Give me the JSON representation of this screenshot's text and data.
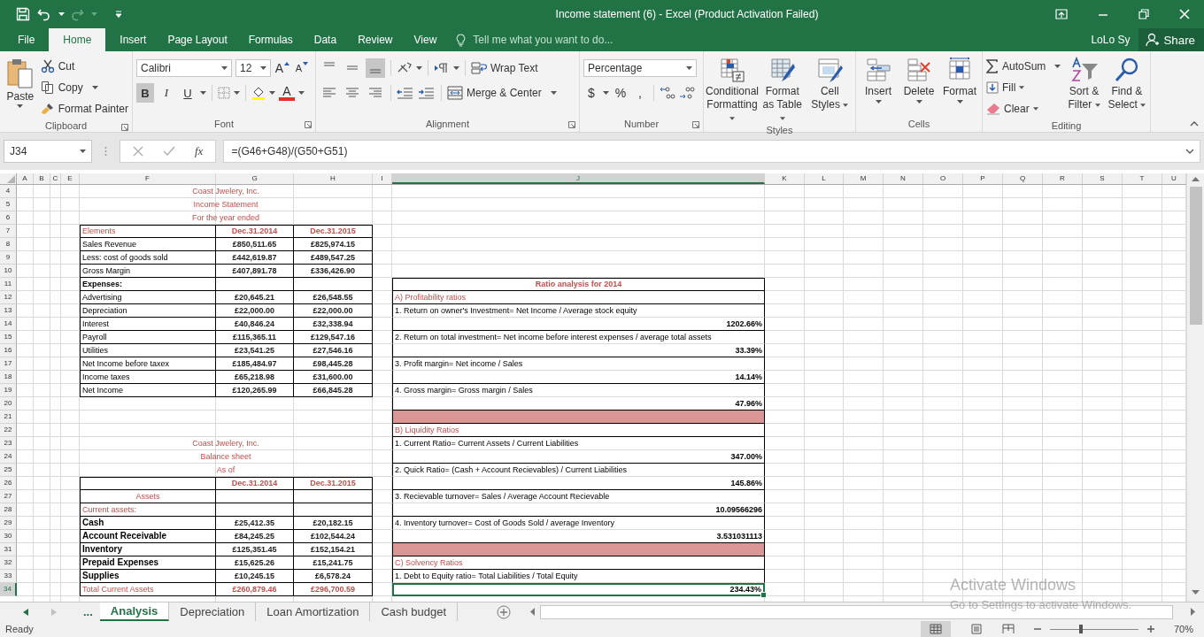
{
  "window": {
    "title": "Income statement (6) - Excel (Product Activation Failed)"
  },
  "ribbon_tabs": [
    {
      "label": "File",
      "selected": false
    },
    {
      "label": "Home",
      "selected": true
    },
    {
      "label": "Insert",
      "selected": false
    },
    {
      "label": "Page Layout",
      "selected": false
    },
    {
      "label": "Formulas",
      "selected": false
    },
    {
      "label": "Data",
      "selected": false
    },
    {
      "label": "Review",
      "selected": false
    },
    {
      "label": "View",
      "selected": false
    }
  ],
  "tell_me": {
    "placeholder": "Tell me what you want to do..."
  },
  "account": {
    "user": "LoLo Sy",
    "share": "Share"
  },
  "ribbon": {
    "clipboard": {
      "label": "Clipboard",
      "paste": "Paste",
      "cut": "Cut",
      "copy": "Copy",
      "format_painter": "Format Painter"
    },
    "font": {
      "label": "Font",
      "font_name": "Calibri",
      "font_size": "12",
      "grow": "A",
      "shrink": "A",
      "styles": [
        {
          "label": "B",
          "on": true
        },
        {
          "label": "I",
          "on": false
        },
        {
          "label": "U",
          "on": false
        }
      ],
      "font_color": "A"
    },
    "alignment": {
      "label": "Alignment",
      "vertical": [
        {
          "on": false
        },
        {
          "on": false
        },
        {
          "on": true
        }
      ],
      "wrap_text": "Wrap Text",
      "merge_center": "Merge & Center"
    },
    "number": {
      "label": "Number",
      "format": "Percentage",
      "currency": "$",
      "percent": "%",
      "comma": ","
    },
    "styles": {
      "label": "Styles",
      "commands": [
        "Conditional Formatting",
        "Format as Table",
        "Cell Styles"
      ]
    },
    "cells": {
      "label": "Cells",
      "commands": [
        "Insert",
        "Delete",
        "Format"
      ]
    },
    "editing": {
      "label": "Editing",
      "autosum": "AutoSum",
      "fill": "Fill",
      "clear": "Clear",
      "sort_filter": "Sort & Filter",
      "find_select": "Find & Select"
    }
  },
  "formula_bar": {
    "name_box": "J34",
    "function_label": "fx",
    "formula": "=(G46+G48)/(G50+G51)"
  },
  "sheet": {
    "column_headers": [
      {
        "label": "A",
        "selected": false
      },
      {
        "label": "B",
        "selected": false
      },
      {
        "label": "C",
        "selected": false
      },
      {
        "label": "E",
        "selected": false
      },
      {
        "label": "F",
        "selected": false
      },
      {
        "label": "G",
        "selected": false
      },
      {
        "label": "H",
        "selected": false
      },
      {
        "label": "I",
        "selected": false
      },
      {
        "label": "J",
        "selected": true
      },
      {
        "label": "K",
        "selected": false
      },
      {
        "label": "L",
        "selected": false
      },
      {
        "label": "M",
        "selected": false
      },
      {
        "label": "N",
        "selected": false
      },
      {
        "label": "O",
        "selected": false
      },
      {
        "label": "P",
        "selected": false
      },
      {
        "label": "Q",
        "selected": false
      },
      {
        "label": "R",
        "selected": false
      },
      {
        "label": "S",
        "selected": false
      },
      {
        "label": "T",
        "selected": false
      },
      {
        "label": "U",
        "selected": false
      }
    ],
    "row_headers": [
      {
        "label": "4",
        "selected": false
      },
      {
        "label": "5",
        "selected": false
      },
      {
        "label": "6",
        "selected": false
      },
      {
        "label": "7",
        "selected": false
      },
      {
        "label": "8",
        "selected": false
      },
      {
        "label": "9",
        "selected": false
      },
      {
        "label": "10",
        "selected": false
      },
      {
        "label": "11",
        "selected": false
      },
      {
        "label": "12",
        "selected": false
      },
      {
        "label": "13",
        "selected": false
      },
      {
        "label": "14",
        "selected": false
      },
      {
        "label": "15",
        "selected": false
      },
      {
        "label": "16",
        "selected": false
      },
      {
        "label": "17",
        "selected": false
      },
      {
        "label": "18",
        "selected": false
      },
      {
        "label": "19",
        "selected": false
      },
      {
        "label": "20",
        "selected": false
      },
      {
        "label": "21",
        "selected": false
      },
      {
        "label": "22",
        "selected": false
      },
      {
        "label": "23",
        "selected": false
      },
      {
        "label": "24",
        "selected": false
      },
      {
        "label": "25",
        "selected": false
      },
      {
        "label": "26",
        "selected": false
      },
      {
        "label": "27",
        "selected": false
      },
      {
        "label": "28",
        "selected": false
      },
      {
        "label": "29",
        "selected": false
      },
      {
        "label": "30",
        "selected": false
      },
      {
        "label": "31",
        "selected": false
      },
      {
        "label": "32",
        "selected": false
      },
      {
        "label": "33",
        "selected": false
      },
      {
        "label": "34",
        "selected": true
      }
    ],
    "income_statement": {
      "titles": [
        "Coast Jwelery, Inc.",
        "Income Statement",
        "For the year ended"
      ],
      "rows": [
        {
          "kind": "header",
          "label": "Elements",
          "values": [
            "Dec.31.2014",
            "Dec.31.2015"
          ]
        },
        {
          "kind": "item",
          "label": "Sales Revenue",
          "values": [
            "£850,511.65",
            "£825,974.15"
          ]
        },
        {
          "kind": "item",
          "label": "Less: cost of goods sold",
          "values": [
            "£442,619.87",
            "£489,547.25"
          ]
        },
        {
          "kind": "item",
          "label": "Gross Margin",
          "values": [
            "£407,891.78",
            "£336,426.90"
          ]
        },
        {
          "kind": "subhead",
          "label": "Expenses:"
        },
        {
          "kind": "item",
          "label": "Advertising",
          "values": [
            "£20,645.21",
            "£26,548.55"
          ]
        },
        {
          "kind": "item",
          "label": "Depreciation",
          "values": [
            "£22,000.00",
            "£22,000.00"
          ]
        },
        {
          "kind": "item",
          "label": "Interest",
          "values": [
            "£40,846.24",
            "£32,338.94"
          ]
        },
        {
          "kind": "item",
          "label": "Payroll",
          "values": [
            "£115,365.11",
            "£129,547.16"
          ]
        },
        {
          "kind": "item",
          "label": "Utilities",
          "values": [
            "£23,541.25",
            "£27,546.16"
          ]
        },
        {
          "kind": "item",
          "label": "Net Income before taxex",
          "values": [
            "£185,484.97",
            "£98,445.28"
          ]
        },
        {
          "kind": "item",
          "label": "Income taxes",
          "values": [
            "£65,218.98",
            "£31,600.00"
          ]
        },
        {
          "kind": "item",
          "label": "Net Income",
          "values": [
            "£120,265.99",
            "£66,845.28"
          ]
        }
      ]
    },
    "balance_sheet": {
      "titles": [
        "Coast Jwelery, Inc.",
        "Balance sheet",
        "As of"
      ],
      "rows": [
        {
          "kind": "header",
          "values": [
            "Dec.31.2014",
            "Dec.31.2015"
          ]
        },
        {
          "kind": "section",
          "label": "Assets"
        },
        {
          "kind": "category",
          "label": "Current assets:"
        },
        {
          "kind": "strong",
          "label": "Cash",
          "values": [
            "£25,412.35",
            "£20,182.15"
          ]
        },
        {
          "kind": "strong",
          "label": "Account Receivable",
          "values": [
            "£84,245.25",
            "£102,544.24"
          ]
        },
        {
          "kind": "strong",
          "label": "Inventory",
          "values": [
            "£125,351.45",
            "£152,154.21"
          ]
        },
        {
          "kind": "strong",
          "label": "Prepaid Expenses",
          "values": [
            "£15,625.26",
            "£15,241.75"
          ]
        },
        {
          "kind": "strong",
          "label": "Supplies",
          "values": [
            "£10,245.15",
            "£6,578.24"
          ]
        },
        {
          "kind": "total",
          "label": "Total Current Assets",
          "values": [
            "£260,879.46",
            "£296,700.59"
          ]
        }
      ]
    },
    "ratio_analysis": {
      "rows": [
        {
          "kind": "title",
          "text": "Ratio analysis for 2014",
          "selected": false
        },
        {
          "kind": "heading",
          "text": "A) Profitability ratios",
          "selected": false
        },
        {
          "kind": "formula",
          "text": "1. Return on owner's Investment= Net Income / Average stock equity",
          "selected": false
        },
        {
          "kind": "value",
          "text": "1202.66%",
          "selected": false
        },
        {
          "kind": "formula",
          "text": "2. Return on total investment=  Net income before interest expenses / average total assets",
          "selected": false
        },
        {
          "kind": "value",
          "text": "33.39%",
          "selected": false
        },
        {
          "kind": "formula",
          "text": "3. Profit margin= Net income / Sales",
          "selected": false
        },
        {
          "kind": "value",
          "text": "14.14%",
          "selected": false
        },
        {
          "kind": "formula",
          "text": "4. Gross margin= Gross margin / Sales",
          "selected": false
        },
        {
          "kind": "value",
          "text": "47.96%",
          "selected": false
        },
        {
          "kind": "band",
          "selected": false
        },
        {
          "kind": "heading",
          "text": "B) Liquidity Ratios",
          "selected": false
        },
        {
          "kind": "formula",
          "text": "1. Current Ratio= Current Assets / Current Liabilities",
          "selected": false
        },
        {
          "kind": "value",
          "text": "347.00%",
          "selected": false
        },
        {
          "kind": "formula",
          "text": "2. Quick Ratio= (Cash + Account Recievables) / Current Liabilities",
          "selected": false
        },
        {
          "kind": "value",
          "text": "145.86%",
          "selected": false
        },
        {
          "kind": "formula",
          "text": "3. Recievable turnover= Sales / Average Account Recievable",
          "selected": false
        },
        {
          "kind": "value",
          "text": "10.09566296",
          "selected": false
        },
        {
          "kind": "formula",
          "text": "4. Inventory turnover= Cost of Goods Sold / average Inventory",
          "selected": false
        },
        {
          "kind": "value",
          "text": "3.531031113",
          "selected": false
        },
        {
          "kind": "band",
          "selected": false
        },
        {
          "kind": "heading",
          "text": "C) Solvency Ratios",
          "selected": false
        },
        {
          "kind": "formula",
          "text": "1. Debt to Equity ratio= Total Liabilities / Total Equity",
          "selected": false
        },
        {
          "kind": "value",
          "text": "234.43%",
          "selected": true
        }
      ]
    }
  },
  "sheet_tabs": {
    "overflow": "...",
    "tabs": [
      {
        "label": "Analysis",
        "selected": true
      },
      {
        "label": "Depreciation",
        "selected": false
      },
      {
        "label": "Loan Amortization",
        "selected": false
      },
      {
        "label": "Cash budget",
        "selected": false
      }
    ]
  },
  "status_bar": {
    "status": "Ready",
    "zoom": "70%",
    "level": 0.35
  },
  "activation_notice": {
    "title": "Activate Windows",
    "subtitle": "Go to Settings to activate Windows."
  }
}
